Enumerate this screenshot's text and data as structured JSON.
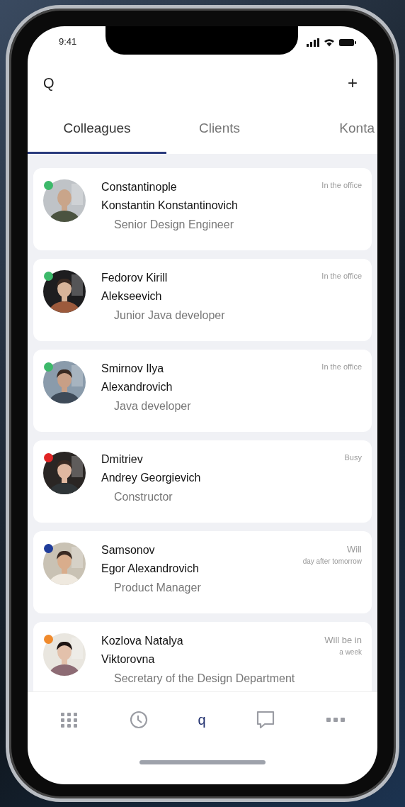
{
  "status_bar": {
    "time": "9:41"
  },
  "header": {
    "search": "Q",
    "add": "+"
  },
  "tabs": [
    {
      "label": "Colleagues",
      "selected": true
    },
    {
      "label": "Clients",
      "selected": false
    },
    {
      "label": "Konta",
      "selected": false
    }
  ],
  "colleagues": [
    {
      "name_lines": [
        "Constantinople",
        "Konstantin Konstantinovich"
      ],
      "role": "Senior Design Engineer",
      "status": [
        "In the office"
      ],
      "color": "#3cb96a"
    },
    {
      "name_lines": [
        "Fedorov Kirill",
        "Alekseevich"
      ],
      "role": "Junior Java developer",
      "status": [
        "In the office"
      ],
      "color": "#3cb96a"
    },
    {
      "name_lines": [
        "Smirnov Ilya",
        "Alexandrovich"
      ],
      "role": "Java developer",
      "status": [
        "In the office"
      ],
      "color": "#3cb96a"
    },
    {
      "name_lines": [
        "Dmitriev",
        "Andrey Georgievich"
      ],
      "role": "Constructor",
      "status": [
        "Busy"
      ],
      "color": "#e02424"
    },
    {
      "name_lines": [
        "Samsonov",
        "Egor Alexandrovich"
      ],
      "role": "Product Manager",
      "status": [
        "Will",
        "day after tomorrow"
      ],
      "color": "#1f3c9a"
    },
    {
      "name_lines": [
        "Kozlova Natalya",
        "Viktorovna"
      ],
      "role": "Secretary of the Design Department",
      "status": [
        "Will be in",
        "a week"
      ],
      "color": "#f08a2c"
    }
  ],
  "bottom_nav": [
    {
      "kind": "grid",
      "selected": false
    },
    {
      "kind": "clock",
      "selected": false
    },
    {
      "kind": "text",
      "label": "q",
      "selected": true
    },
    {
      "kind": "chat",
      "selected": false
    },
    {
      "kind": "more",
      "selected": false
    }
  ]
}
